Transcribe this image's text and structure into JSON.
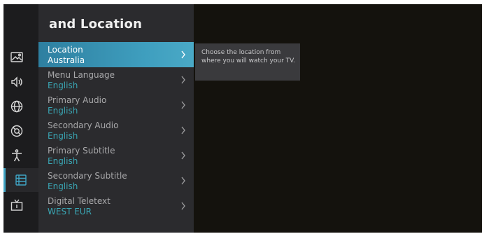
{
  "screen": {
    "title": "and Location"
  },
  "sidebar": {
    "icons": [
      {
        "name": "picture-icon"
      },
      {
        "name": "sound-icon"
      },
      {
        "name": "network-icon"
      },
      {
        "name": "support-icon"
      },
      {
        "name": "accessibility-icon"
      },
      {
        "name": "system-icon",
        "active": true
      },
      {
        "name": "tv-icon"
      }
    ],
    "accent_color": "#3fa4c4"
  },
  "menu": {
    "items": [
      {
        "label": "Location",
        "value": "Australia"
      },
      {
        "label": "Menu Language",
        "value": "English"
      },
      {
        "label": "Primary Audio",
        "value": "English"
      },
      {
        "label": "Secondary Audio",
        "value": "English"
      },
      {
        "label": "Primary Subtitle",
        "value": "English"
      },
      {
        "label": "Secondary Subtitle",
        "value": "English"
      },
      {
        "label": "Digital Teletext",
        "value": "WEST EUR"
      }
    ],
    "selected_index": 0
  },
  "tooltip": {
    "text": "Choose the location from where you will watch your TV."
  }
}
